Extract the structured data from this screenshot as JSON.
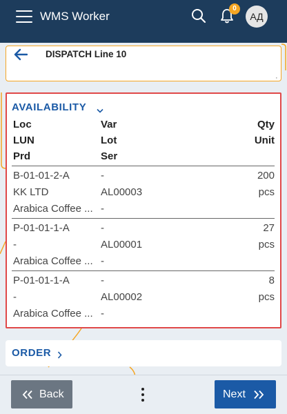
{
  "app": {
    "title": "WMS Worker",
    "notification_count": "0",
    "user_initials": "АД"
  },
  "header": {
    "title": "DISPATCH Line 10",
    "trailing_mark": "·"
  },
  "availability": {
    "title": "AVAILABILITY",
    "columns": {
      "loc": "Loc",
      "var": "Var",
      "qty": "Qty",
      "lun": "LUN",
      "lot": "Lot",
      "unit": "Unit",
      "prd": "Prd",
      "ser": "Ser"
    },
    "rows": [
      {
        "loc": "B-01-01-2-A",
        "var": "-",
        "qty": "200",
        "lun": "KK LTD",
        "lot": "AL00003",
        "unit": "pcs",
        "prd": "Arabica Coffee ...",
        "ser": "-"
      },
      {
        "loc": "P-01-01-1-A",
        "var": "-",
        "qty": "27",
        "lun": "-",
        "lot": "AL00001",
        "unit": "pcs",
        "prd": "Arabica Coffee ...",
        "ser": "-"
      },
      {
        "loc": "P-01-01-1-A",
        "var": "-",
        "qty": "8",
        "lun": "-",
        "lot": "AL00002",
        "unit": "pcs",
        "prd": "Arabica Coffee ...",
        "ser": "-"
      }
    ]
  },
  "order": {
    "title": "ORDER"
  },
  "footer": {
    "back_label": "Back",
    "next_label": "Next"
  },
  "colors": {
    "app_bar": "#1d3c5c",
    "accent": "#1b5aa6",
    "badge": "#f5a623",
    "highlight_border": "#e04848",
    "back_button": "#6b7682"
  },
  "icons": [
    "menu-icon",
    "search-icon",
    "bell-icon",
    "back-arrow-icon",
    "chevron-down-icon",
    "chevron-right-icon",
    "double-chevron-left-icon",
    "double-chevron-right-icon",
    "more-vertical-icon"
  ]
}
